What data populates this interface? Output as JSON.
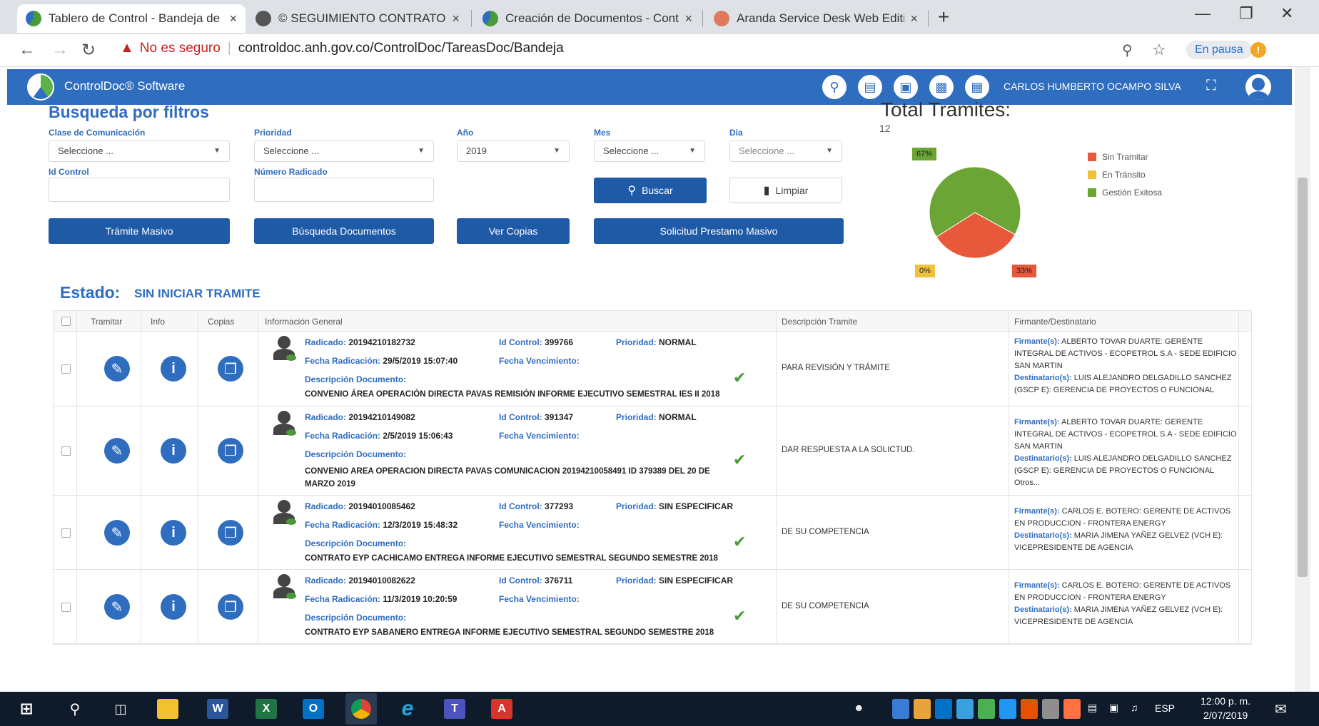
{
  "browser": {
    "tabs": [
      {
        "title": "Tablero de Control - Bandeja de",
        "active": true
      },
      {
        "title": "© SEGUIMIENTO CONTRATOS v",
        "active": false
      },
      {
        "title": "Creación de Documentos - Cont",
        "active": false
      },
      {
        "title": "Aranda Service Desk Web Edition",
        "active": false
      }
    ],
    "close_glyph": "×",
    "new_tab_glyph": "+",
    "insecure_label": "No es seguro",
    "url": "controldoc.anh.gov.co/ControlDoc/TareasDoc/Bandeja",
    "pause_label": "En pausa"
  },
  "app": {
    "title": "ControlDoc® Software",
    "user": "CARLOS HUMBERTO OCAMPO SILVA",
    "header_icons": [
      "search-icon",
      "document-icon",
      "inbox-icon",
      "print-icon",
      "report-icon"
    ]
  },
  "filters": {
    "title": "Busqueda por filtros",
    "clase_label": "Clase de Comunicación",
    "clase_value": "Seleccione ...",
    "prioridad_label": "Prioridad",
    "prioridad_value": "Seleccione ...",
    "anio_label": "Año",
    "anio_value": "2019",
    "mes_label": "Mes",
    "mes_value": "Seleccione ...",
    "dia_label": "Dia",
    "dia_value": "Seleccione ...",
    "idcontrol_label": "Id Control",
    "radicado_label": "Número Radicado",
    "buscar_label": "Buscar",
    "limpiar_label": "Limpiar",
    "tramite_masivo_label": "Trámite Masivo",
    "busqueda_docs_label": "Búsqueda Documentos",
    "ver_copias_label": "Ver Copias",
    "solicitud_label": "Solicitud Prestamo Masivo"
  },
  "chart_data": {
    "type": "pie",
    "title": "Total Tramites:",
    "subtitle": "12",
    "slices": [
      {
        "name": "Sin Tramitar",
        "value": 33,
        "label": "33%",
        "color": "#e8583a"
      },
      {
        "name": "En Tránsito",
        "value": 0,
        "label": "0%",
        "color": "#f0c23b"
      },
      {
        "name": "Gestión Exitosa",
        "value": 67,
        "label": "67%",
        "color": "#6aa535"
      }
    ],
    "legend_position": "right"
  },
  "estado": {
    "label": "Estado:",
    "value": "SIN INICIAR TRAMITE"
  },
  "table": {
    "headers": [
      "Tramitar",
      "Info",
      "Copias",
      "Información General",
      "Descripción Tramite",
      "Firmante/Destinatario"
    ],
    "field_labels": {
      "radicado": "Radicado:",
      "idcontrol": "Id Control:",
      "prioridad": "Prioridad:",
      "fecha_rad": "Fecha Radicación:",
      "fecha_venc": "Fecha Vencimiento:",
      "descripcion": "Descripción Documento:",
      "firmante": "Firmante(s):",
      "destinatario": "Destinatario(s):"
    },
    "rows": [
      {
        "radicado": "20194210182732",
        "idcontrol": "399766",
        "prioridad": "NORMAL",
        "fecha_rad": "29/5/2019 15:07:40",
        "descripcion": "CONVENIO ÁREA OPERACIÓN DIRECTA PAVAS REMISIÓN INFORME EJECUTIVO SEMESTRAL IES II 2018",
        "tramite": "PARA REVISIÓN Y TRÁMITE",
        "firmante": "ALBERTO TOVAR DUARTE: GERENTE INTEGRAL DE ACTIVOS - ECOPETROL S.A - SEDE EDIFICIO SAN MARTIN",
        "destinatario": "LUIS ALEJANDRO DELGADILLO SANCHEZ (GSCP E): GERENCIA DE PROYECTOS O FUNCIONAL"
      },
      {
        "radicado": "20194210149082",
        "idcontrol": "391347",
        "prioridad": "NORMAL",
        "fecha_rad": "2/5/2019 15:06:43",
        "descripcion": "CONVENIO AREA OPERACION DIRECTA PAVAS COMUNICACION 20194210058491 ID 379389 DEL 20 DE MARZO 2019",
        "tramite": "DAR RESPUESTA A LA SOLICTUD.",
        "firmante": "ALBERTO TOVAR DUARTE: GERENTE INTEGRAL DE ACTIVOS - ECOPETROL S.A - SEDE EDIFICIO SAN MARTIN",
        "destinatario": "LUIS ALEJANDRO DELGADILLO SANCHEZ (GSCP E): GERENCIA DE PROYECTOS O FUNCIONAL Otros..."
      },
      {
        "radicado": "20194010085462",
        "idcontrol": "377293",
        "prioridad": "SIN ESPECIFICAR",
        "fecha_rad": "12/3/2019 15:48:32",
        "descripcion": "CONTRATO EYP CACHICAMO ENTREGA INFORME EJECUTIVO SEMESTRAL SEGUNDO SEMESTRE 2018",
        "tramite": "DE SU COMPETENCIA",
        "firmante": "CARLOS E. BOTERO: GERENTE DE ACTIVOS EN PRODUCCION - FRONTERA ENERGY",
        "destinatario": "MARIA JIMENA YAÑEZ GELVEZ (VCH E): VICEPRESIDENTE DE AGENCIA"
      },
      {
        "radicado": "20194010082622",
        "idcontrol": "376711",
        "prioridad": "SIN ESPECIFICAR",
        "fecha_rad": "11/3/2019 10:20:59",
        "descripcion": "CONTRATO EYP SABANERO ENTREGA INFORME EJECUTIVO SEMESTRAL SEGUNDO SEMESTRE 2018",
        "tramite": "DE SU COMPETENCIA",
        "firmante": "CARLOS E. BOTERO: GERENTE DE ACTIVOS EN PRODUCCION - FRONTERA ENERGY",
        "destinatario": "MARIA JIMENA YAÑEZ GELVEZ (VCH E): VICEPRESIDENTE DE AGENCIA"
      }
    ]
  },
  "taskbar": {
    "lang": "ESP",
    "time": "12:00 p. m.",
    "date": "2/07/2019"
  }
}
